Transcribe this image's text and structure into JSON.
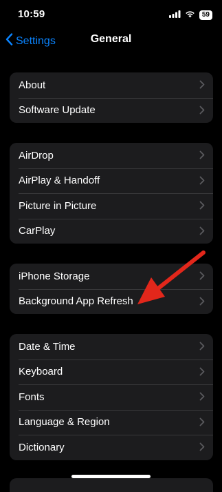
{
  "status_bar": {
    "time": "10:59",
    "battery": "59"
  },
  "nav": {
    "back_label": "Settings",
    "title": "General"
  },
  "groups": [
    {
      "items": [
        "About",
        "Software Update"
      ]
    },
    {
      "items": [
        "AirDrop",
        "AirPlay & Handoff",
        "Picture in Picture",
        "CarPlay"
      ]
    },
    {
      "items": [
        "iPhone Storage",
        "Background App Refresh"
      ]
    },
    {
      "items": [
        "Date & Time",
        "Keyboard",
        "Fonts",
        "Language & Region",
        "Dictionary"
      ]
    }
  ],
  "colors": {
    "accent": "#0a84ff",
    "annotation_arrow": "#e2271b",
    "cell": "#1c1c1e"
  },
  "icons": [
    "back-chevron-icon",
    "chevron-right-icon",
    "signal-icon",
    "wifi-icon",
    "battery-icon"
  ]
}
